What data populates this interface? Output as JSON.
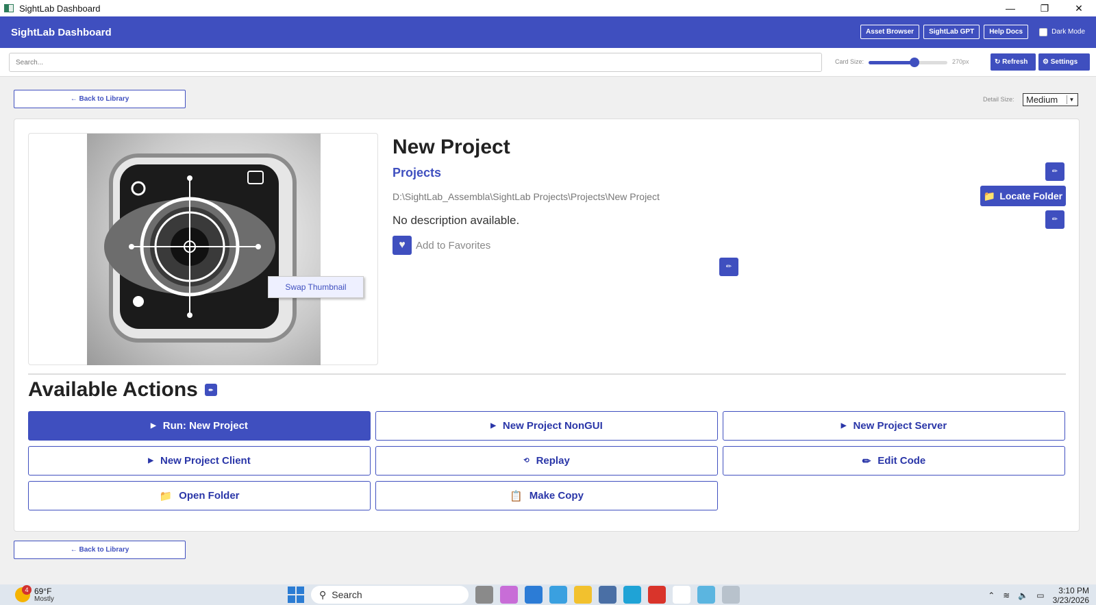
{
  "window": {
    "title": "SightLab Dashboard",
    "minimize": "—",
    "maximize": "❐",
    "close": "✕"
  },
  "header": {
    "brand": "SightLab Dashboard",
    "asset_browser": "Asset Browser",
    "sightlab_gpt": "SightLab GPT",
    "help_docs": "Help Docs",
    "dark_mode": "Dark Mode"
  },
  "toolbar": {
    "search_placeholder": "Search...",
    "card_size_label": "Card Size:",
    "card_size_value": "270px",
    "card_size_fraction": 0.58,
    "refresh": "↻ Refresh",
    "settings": "⚙ Settings"
  },
  "nav": {
    "back": "← Back to Library",
    "detail_size_label": "Detail Size:",
    "detail_size_value": "Medium"
  },
  "project": {
    "title": "New Project",
    "category": "Projects",
    "path": "D:\\SightLab_Assembla\\SightLab Projects\\Projects\\New Project",
    "description": "No description available.",
    "favorites": "Add to Favorites",
    "swap_thumbnail": "Swap Thumbnail",
    "locate_folder": "Locate Folder"
  },
  "actions": {
    "title": "Available Actions",
    "buttons": [
      {
        "label": "Run: New Project",
        "icon": "▶"
      },
      {
        "label": "New Project NonGUI",
        "icon": "▶"
      },
      {
        "label": "New Project Server",
        "icon": "▶"
      },
      {
        "label": "New Project Client",
        "icon": "▶"
      },
      {
        "label": "Replay",
        "icon": "⟲"
      },
      {
        "label": "Edit Code",
        "icon": "✏"
      },
      {
        "label": "Open Folder",
        "icon": "📁"
      },
      {
        "label": "Make Copy",
        "icon": "📋"
      }
    ]
  },
  "taskbar": {
    "weather_temp": "69°F",
    "weather_sub": "Mostly",
    "badge": "4",
    "search": "Search",
    "time": "3:10 PM",
    "date": "3/23/2026"
  },
  "colors": {
    "accent": "#3f4fbf",
    "text": "#222222"
  }
}
